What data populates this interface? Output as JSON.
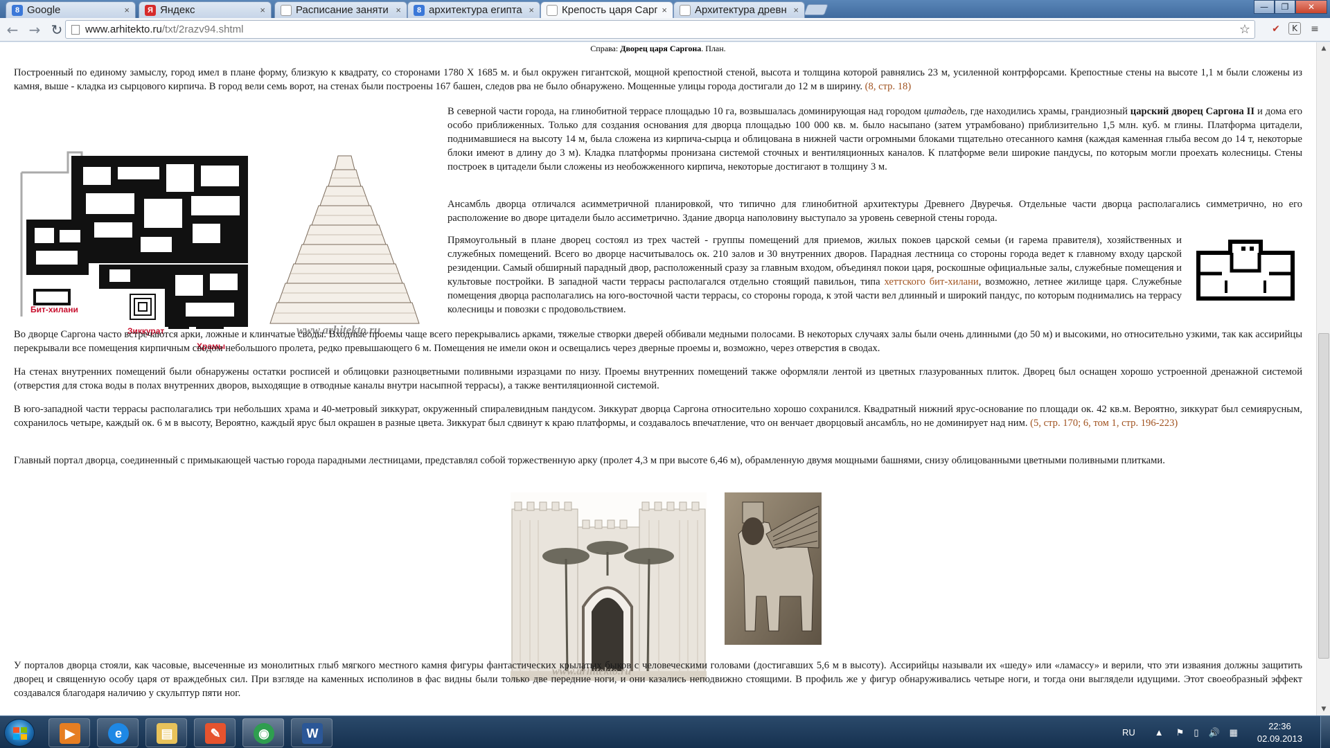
{
  "browser": {
    "tabs": [
      {
        "title": "Google",
        "favicon": "8",
        "color": "#3b78d8"
      },
      {
        "title": "Яндекс",
        "favicon": "Я",
        "color": "#d62b2b"
      },
      {
        "title": "Расписание заняти",
        "favicon": "",
        "color": "#ffffff"
      },
      {
        "title": "архитектура египта",
        "favicon": "8",
        "color": "#3b78d8"
      },
      {
        "title": "Крепость царя Сарг",
        "favicon": "",
        "color": "#ffffff"
      },
      {
        "title": "Архитектура древн",
        "favicon": "",
        "color": "#ffffff"
      }
    ],
    "close_glyph": "×",
    "window_buttons": {
      "minimize": "—",
      "restore": "❐",
      "close": "✕"
    },
    "nav": {
      "back": "←",
      "forward": "→",
      "reload": "↻"
    },
    "url_host": "www.arhitekto.ru",
    "url_path": "/txt/2razv94.shtml",
    "star": "☆"
  },
  "page": {
    "top_caption_prefix": "Справа: ",
    "top_caption_bold": "Дворец царя Саргона",
    "top_caption_suffix": ". План.",
    "para1": "Построенный по единому замыслу, город имел в плане форму, близкую к квадрату, со сторонами 1780 X 1685 м. и был окружен гигантской, мощной крепостной стеной, высота и толщина которой равнялись 23 м, усиленной контрфорсами. Крепостные стены на высоте 1,1 м были сложены из камня, выше - кладка из сырцового кирпича. В город вели семь ворот, на стенах были построены 167 башен, следов рва не было обнаружено. Мощенные улицы города достигали до 12 м в ширину.",
    "para1_ref": "(8, стр. 18)",
    "para2_a": "В северной части города, на глинобитной террасе площадью 10 га, возвышалась доминирующая над городом ",
    "para2_italic": "цитадель",
    "para2_b": ", где находились храмы, грандиозный ",
    "para2_bold": "царский дворец Саргона II",
    "para2_c": " и дома его особо приближенных. Только для создания основания для дворца площадью 100 000 кв. м. было насыпано (затем утрамбовано) приблизительно 1,5 млн. куб. м глины. Платформа цитадели, поднимавшиеся на высоту 14 м, была сложена из кирпича-сырца и облицована в нижней части огромными блоками тщательно отесанного камня (каждая каменная глыба весом до 14 т, некоторые блоки имеют в длину до 3 м). Кладка платформы пронизана системой сточных и вентиляционных каналов. К платформе вели широкие пандусы, по которым могли проехать колесницы. Стены построек в цитадели были сложены из необожженного кирпича, некоторые достигают в толщину 3 м.",
    "para3": "Ансамбль дворца отличался асимметричной планировкой, что типично для глинобитной архитектуры Древнего Двуречья. Отдельные части дворца располагались симметрично, но его расположение во дворе цитадели было ассиметрично. Здание дворца наполовину выступало за уровень северной стены города.",
    "para4_a": "Прямоугольный в плане дворец состоял из трех частей - группы помещений для приемов, жилых покоев царской семьи (и гарема правителя), хозяйственных и служебных помещений. Всего во дворце насчитывалось ок. 210 залов и 30 внутренних дворов. Парадная лестница со стороны города ведет к главному входу царской резиденции. Самый обширный парадный двор, расположенный сразу за главным входом, объединял покои царя, роскошные официальные залы, служебные помещения и культовые постройки. В западной части террасы располагался отдельно стоящий павильон, типа ",
    "para4_link": "хеттского бит-хилани",
    "para4_b": ", возможно, летнее жилище царя. Служебные помещения дворца располагались на юго-восточной части террасы, со стороны города, к этой части вел длинный и широкий пандус, по которым поднимались на террасу колесницы и повозки с продовольствием.",
    "para5": "Во дворце Саргона часто встречаются арки, ложные и клинчатые своды. Входные проемы чаще всего перекрывались арками, тяжелые створки дверей оббивали медными полосами. В некоторых случаях залы были очень длинными (до 50 м) и высокими, но относительно узкими, так как ассирийцы перекрывали все помещения кирпичным сводом небольшого пролета, редко превышающего 6 м. Помещения не имели окон и освещались через дверные проемы и, возможно, через отверстия в сводах.",
    "para6": "На стенах внутренних помещений были обнаружены остатки росписей и облицовки разноцветными поливными изразцами по низу. Проемы внутренних помещений также оформляли лентой из цветных глазурованных плиток. Дворец был оснащен хорошо устроенной дренажной системой (отверстия для стока воды в полах внутренних дворов, выходящие в отводные каналы внутри насыпной террасы), а также вентиляционной системой.",
    "para7": "В юго-западной части террасы располагались три небольших храма и 40-метровый зиккурат, окруженный спиралевидным пандусом. Зиккурат дворца Саргона относительно хорошо сохранился. Квадратный нижний ярус-основание по площади ок. 42 кв.м. Вероятно, зиккурат был семиярусным, сохранилось четыре, каждый ок. 6 м в высоту, Вероятно, каждый ярус был окрашен в разные цвета. Зиккурат был сдвинут к краю платформы, и создавалось впечатление, что он венчает дворцовый ансамбль, но не доминирует над ним.",
    "para7_ref": "(5, стр. 170; 6, том 1, стр. 196-223)",
    "para8": "Главный портал дворца, соединенный с примыкающей частью города парадными лестницами, представлял собой торжественную арку (пролет 4,3 м при высоте 6,46 м), обрамленную двумя мощными башнями, снизу облицованными цветными поливными плитками.",
    "para9": "У порталов дворца стояли, как часовые, высеченные из монолитных глыб мягкого местного камня фигуры фантастических крылатых быков с человеческими головами (достигавших 5,6 м в высоту). Ассирийцы называли их «шеду» или «ламассу» и верили, что эти изваяния должны защитить дворец и священную особу царя от враждебных сил. При взгляде на каменных исполинов в фас видны были только две передние ноги, и они казались неподвижно стоящими. В профиль же у фигур обнаруживались четыре ноги, и тогда они выглядели идущими. Этот своеобразный эффект создавался благодаря наличию у скульптур пяти ног.",
    "plan_labels": {
      "bit_hilani": "Бит-хилани",
      "ziggurat": "Зиккурат",
      "temples": "Храмы"
    },
    "watermark": "www.arhitekto.ru"
  },
  "taskbar": {
    "apps": [
      {
        "name": "media-player",
        "label": "▶",
        "color": "#e67e22"
      },
      {
        "name": "internet-explorer",
        "label": "e",
        "color": "#1e88e5"
      },
      {
        "name": "file-explorer",
        "label": "▤",
        "color": "#e8c25a"
      },
      {
        "name": "paint-app",
        "label": "✎",
        "color": "#e6532e"
      },
      {
        "name": "chrome",
        "label": "◉",
        "color": "#2e9e4f"
      },
      {
        "name": "word",
        "label": "W",
        "color": "#2b5797"
      }
    ],
    "lang": "RU",
    "time": "22:36",
    "date": "02.09.2013"
  },
  "colors": {
    "link": "#a0521f",
    "plan_label": "#c8102e"
  }
}
